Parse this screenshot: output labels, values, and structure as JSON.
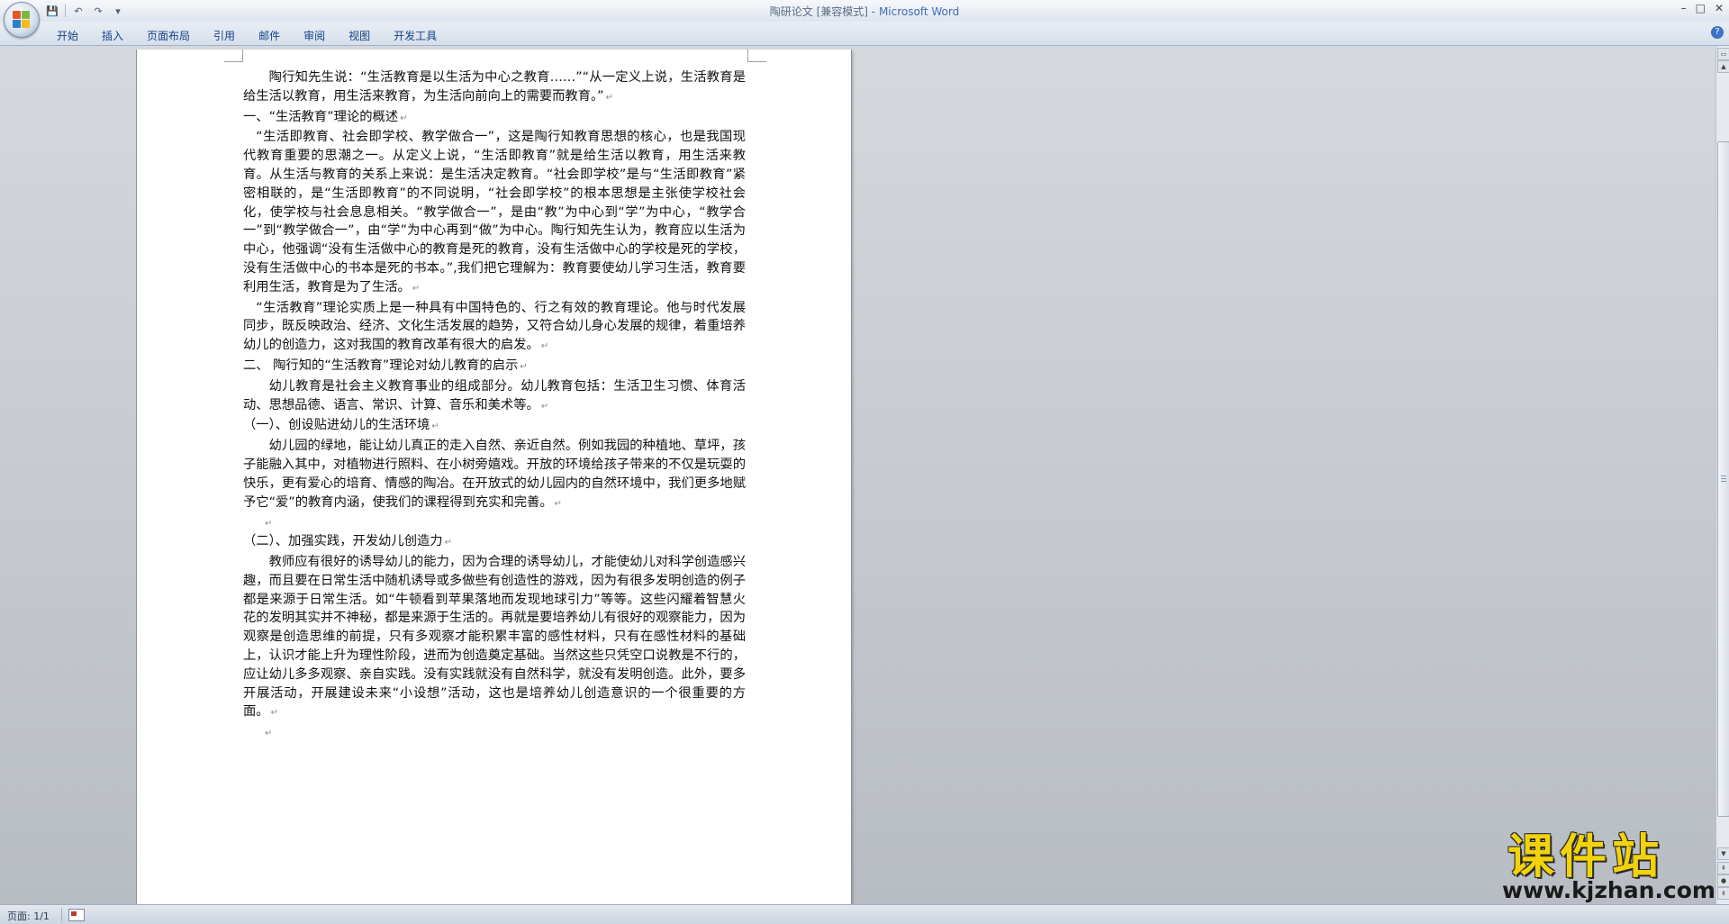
{
  "window": {
    "title_doc": "陶研论文 [兼容模式]",
    "title_sep": " - ",
    "title_app": "Microsoft Word",
    "controls": [
      "–",
      "□",
      "✕"
    ]
  },
  "qat": {
    "save_icon": "💾",
    "undo_icon": "↶",
    "redo_icon": "↷",
    "customize_icon": "▾"
  },
  "ribbon": {
    "tabs": [
      "开始",
      "插入",
      "页面布局",
      "引用",
      "邮件",
      "审阅",
      "视图",
      "开发工具"
    ],
    "help_icon": "?"
  },
  "document": {
    "paragraphs": [
      {
        "text": "陶行知先生说：“生活教育是以生活为中心之教育……”“从一定义上说，生活教育是给生活以教育，用生活来教育，为生活向前向上的需要而教育。”",
        "indent": "indent2"
      },
      {
        "text": "一、“生活教育”理论的概述",
        "indent": ""
      },
      {
        "text": "“生活即教育、社会即学校、教学做合一”，这是陶行知教育思想的核心，也是我国现代教育重要的思潮之一。从定义上说，“生活即教育”就是给生活以教育，用生活来教育。从生活与教育的关系上来说：是生活决定教育。“社会即学校”是与“生活即教育”紧密相联的，是“生活即教育”的不同说明，“社会即学校”的根本思想是主张使学校社会化，使学校与社会息息相关。“教学做合一”，是由“教”为中心到“学”为中心，“教学合一”到“教学做合一”，由“学”为中心再到“做”为中心。陶行知先生认为，教育应以生活为中心，他强调“没有生活做中心的教育是死的教育，没有生活做中心的学校是死的学校，没有生活做中心的书本是死的书本。”,我们把它理解为：教育要使幼儿学习生活，教育要利用生活，教育是为了生活。",
        "indent": "indent1"
      },
      {
        "text": "“生活教育”理论实质上是一种具有中国特色的、行之有效的教育理论。他与时代发展同步，既反映政治、经济、文化生活发展的趋势，又符合幼儿身心发展的规律，着重培养幼儿的创造力，这对我国的教育改革有很大的启发。",
        "indent": "indent1"
      },
      {
        "text": "二、 陶行知的“生活教育”理论对幼儿教育的启示",
        "indent": ""
      },
      {
        "text": "幼儿教育是社会主义教育事业的组成部分。幼儿教育包括：生活卫生习惯、体育活动、思想品德、语言、常识、计算、音乐和美术等。",
        "indent": "indent2"
      },
      {
        "text": "（一）、创设贴进幼儿的生活环境",
        "indent": ""
      },
      {
        "text": "幼儿园的绿地，能让幼儿真正的走入自然、亲近自然。例如我园的种植地、草坪，孩子能融入其中，对植物进行照料、在小树旁嬉戏。开放的环境给孩子带来的不仅是玩耍的快乐，更有爱心的培育、情感的陶冶。在开放式的幼儿园内的自然环境中，我们更多地赋予它“爱”的教育内涵，使我们的课程得到充实和完善。",
        "indent": "indent2"
      },
      {
        "text": "",
        "indent": "blank"
      },
      {
        "text": "（二）、加强实践，开发幼儿创造力",
        "indent": ""
      },
      {
        "text": "教师应有很好的诱导幼儿的能力，因为合理的诱导幼儿，才能使幼儿对科学创造感兴趣，而且要在日常生活中随机诱导或多做些有创造性的游戏，因为有很多发明创造的例子都是来源于日常生活。如“牛顿看到苹果落地而发现地球引力”等等。这些闪耀着智慧火花的发明其实并不神秘，都是来源于生活的。再就是要培养幼儿有很好的观察能力，因为观察是创造思维的前提，只有多观察才能积累丰富的感性材料，只有在感性材料的基础上，认识才能上升为理性阶段，进而为创造奠定基础。当然这些只凭空口说教是不行的，应让幼儿多多观察、亲自实践。没有实践就没有自然科学，就没有发明创造。此外，要多开展活动，开展建设未来“小设想”活动，这也是培养幼儿创造意识的一个很重要的方面。",
        "indent": "indent2"
      },
      {
        "text": "",
        "indent": "blank"
      }
    ],
    "paragraph_mark": "↵"
  },
  "statusbar": {
    "page_info": "页面: 1/1"
  },
  "watermark": {
    "cn": "课件站",
    "url": "www.kjzhan.com"
  },
  "colors": {
    "accent": "#3d6db5",
    "tab_text": "#15428b",
    "watermark_yellow": "#f2d30a"
  }
}
